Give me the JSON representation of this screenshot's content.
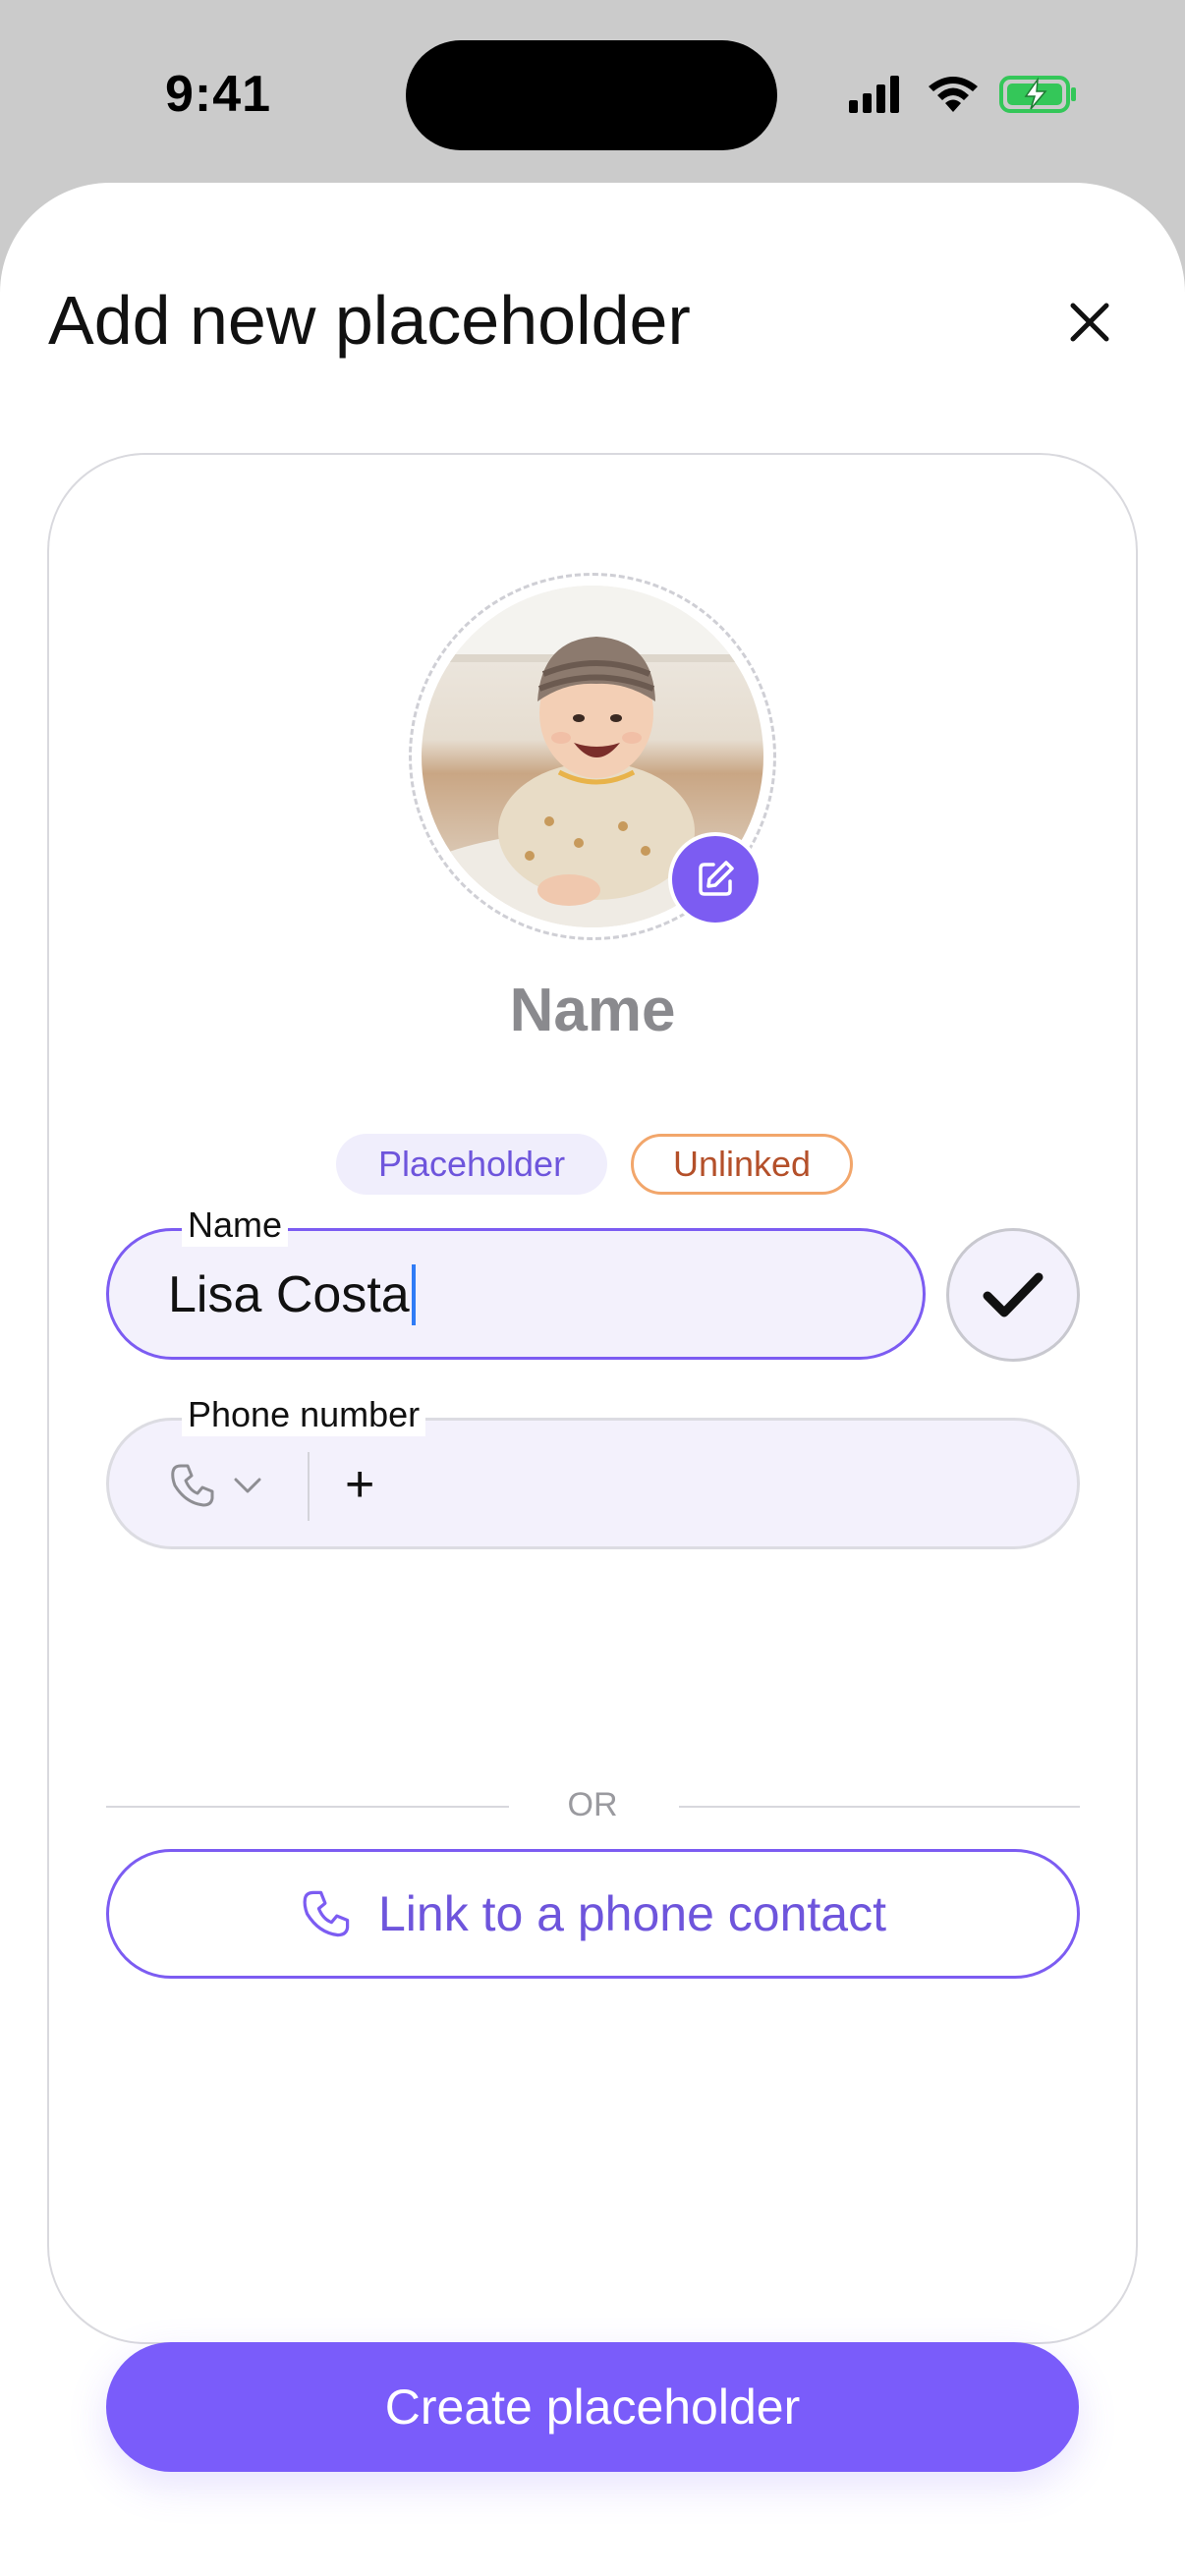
{
  "status_bar": {
    "time": "9:41",
    "icons": [
      "signal-icon",
      "wifi-icon",
      "battery-charging-icon"
    ],
    "battery_color": "#34c759"
  },
  "sheet": {
    "title": "Add new placeholder",
    "close_icon": "close-icon"
  },
  "profile": {
    "display_name": "Name",
    "edit_icon": "edit-icon",
    "badges": {
      "placeholder": "Placeholder",
      "unlinked": "Unlinked"
    }
  },
  "form": {
    "name": {
      "label": "Name",
      "value": "Lisa Costa"
    },
    "confirm_icon": "checkmark-icon",
    "phone": {
      "label": "Phone number",
      "country_icon": "phone-icon",
      "prefix": "+"
    },
    "separator": "OR",
    "link_contact": {
      "label": "Link to a phone contact",
      "icon": "phone-icon"
    }
  },
  "actions": {
    "create_label": "Create placeholder"
  },
  "colors": {
    "accent": "#7a5cfa",
    "badge_placeholder_bg": "#f0eefc",
    "badge_unlinked_border": "#f2a66b",
    "badge_unlinked_text": "#b4502a",
    "caret": "#2f7cf6"
  }
}
